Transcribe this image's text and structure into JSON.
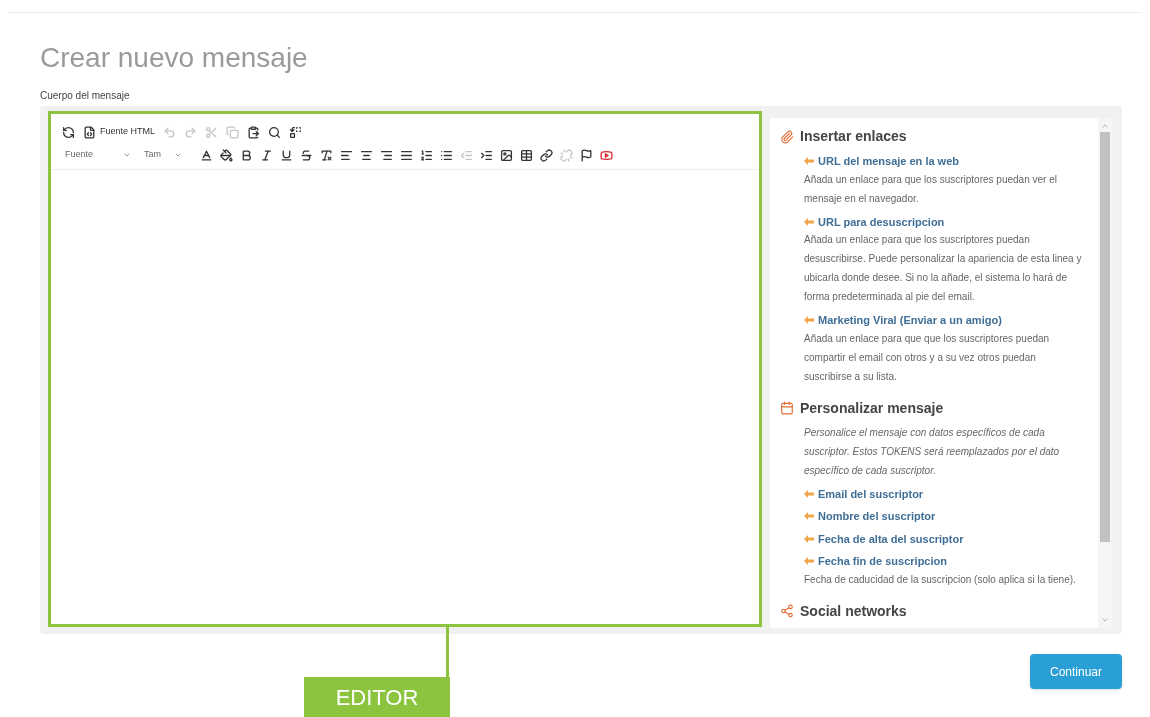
{
  "page_title": "Crear nuevo mensaje",
  "body_label": "Cuerpo del mensaje",
  "toolbar": {
    "row1": [
      {
        "disabled": false
      },
      {
        "label": "Fuente HTML",
        "disabled": false
      },
      {
        "disabled": true
      },
      {
        "disabled": true
      },
      {
        "disabled": true
      },
      {
        "disabled": true
      },
      {
        "disabled": false
      },
      {
        "disabled": false
      },
      {
        "disabled": false
      }
    ],
    "font_select": "Fuente",
    "size_select": "Tam",
    "row2": [
      {
        "disabled": false
      },
      {
        "disabled": false
      },
      {
        "disabled": false
      },
      {
        "disabled": false
      },
      {
        "disabled": false
      },
      {
        "disabled": false
      },
      {
        "disabled": false
      },
      {
        "disabled": false
      },
      {
        "disabled": false
      },
      {
        "disabled": false
      },
      {
        "disabled": false
      },
      {
        "disabled": false
      },
      {
        "disabled": false
      },
      {
        "disabled": true
      },
      {
        "disabled": false
      },
      {
        "disabled": false
      },
      {
        "disabled": false
      },
      {
        "disabled": false
      },
      {
        "disabled": true
      },
      {
        "disabled": false
      },
      {
        "disabled": false
      }
    ]
  },
  "sidebar": {
    "sections": [
      {
        "title": "Insertar enlaces",
        "items": [
          {
            "link": "URL del mensaje en la web",
            "description": "Añada un enlace para que los suscriptores puedan ver el mensaje en el navegador."
          },
          {
            "link": "URL para desuscripcion",
            "description": "Añada un enlace para que los suscriptores puedan desuscribirse. Puede personalizar la apariencia de esta linea y ubicarla donde desee. Si no la añade, el sistema lo hará de forma predeterminada al pie del email."
          },
          {
            "link": "Marketing Viral (Enviar a un amigo)",
            "description": "Añada un enlace para que que los suscriptores puedan compartir el email con otros y a su vez otros puedan suscribirse a su lista."
          }
        ]
      },
      {
        "title": "Personalizar mensaje",
        "description": "Personalice el mensaje con datos específicos de cada suscriptor. Estos TOKENS será reemplazados por el dato específico de cada suscriptor.",
        "items": [
          {
            "link": "Email del suscriptor"
          },
          {
            "link": "Nombre del suscriptor"
          },
          {
            "link": "Fecha de alta del suscriptor"
          },
          {
            "link": "Fecha fin de suscripcion",
            "description": "Fecha de caducidad de la suscripcion (solo aplica si la tiene)."
          }
        ]
      },
      {
        "title": "Social networks"
      }
    ]
  },
  "continue_button": "Continuar",
  "annotation": "EDITOR"
}
